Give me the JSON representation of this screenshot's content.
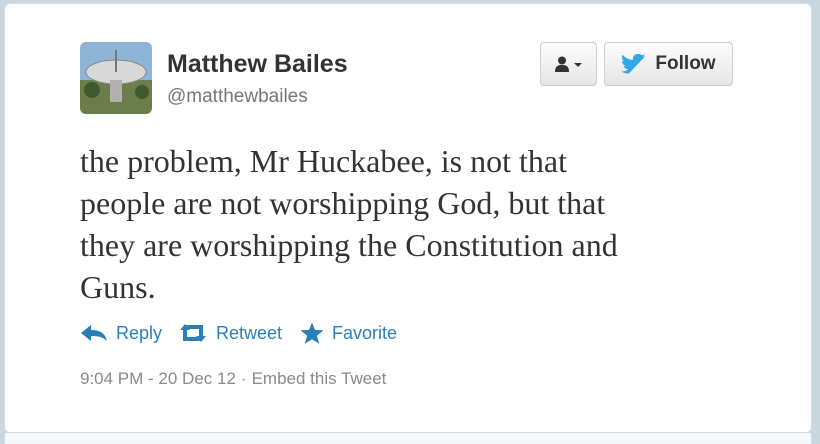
{
  "user": {
    "name": "Matthew Bailes",
    "handle": "@matthewbailes"
  },
  "buttons": {
    "follow_label": "Follow"
  },
  "tweet": {
    "text": "the problem, Mr Huckabee, is not that\npeople are not worshipping God, but that\nthey are worshipping the Constitution and\nGuns."
  },
  "actions": {
    "reply": "Reply",
    "retweet": "Retweet",
    "favorite": "Favorite"
  },
  "meta": {
    "timestamp": "9:04 PM - 20 Dec 12",
    "separator": "·",
    "embed": "Embed this Tweet"
  },
  "colors": {
    "link": "#2a7fb8",
    "twitter_bird": "#2fa8e8"
  },
  "icons": [
    "user-icon",
    "dropdown-caret-icon",
    "twitter-bird-icon",
    "reply-icon",
    "retweet-icon",
    "star-icon"
  ]
}
